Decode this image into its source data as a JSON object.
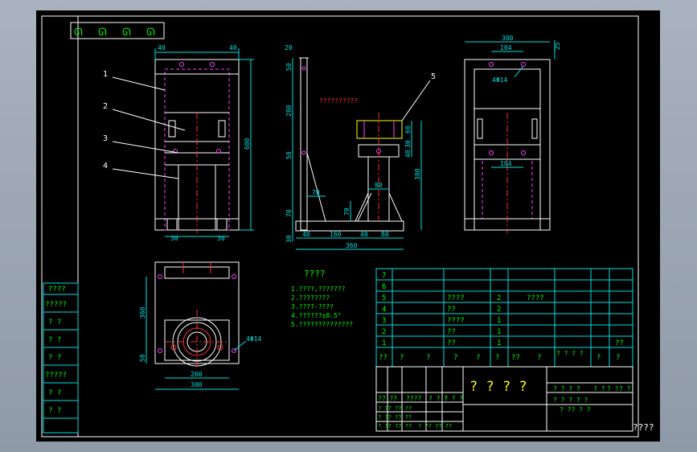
{
  "colors": {
    "background": "#000000",
    "frame": "#ffffff",
    "dim": "#00e0e0",
    "label": "#00ff00",
    "part": "#ffffff",
    "hidden": "#ff40ff",
    "center": "#ff3030",
    "highlight": "#ffff00",
    "screen_bg": "#98a3b1"
  },
  "corner_marks": [
    "ᘏ",
    "ᘏ",
    "ᘏ",
    "ᘏ"
  ],
  "front_view": {
    "dims": {
      "top_left": "40",
      "top_right": "40",
      "height": "600",
      "bottom_left": "30",
      "bottom_right": "30"
    },
    "callouts": [
      "1",
      "2",
      "3",
      "4"
    ]
  },
  "side_view": {
    "dims": {
      "top": "20",
      "v_50a": "50",
      "v_280": "280",
      "v_50b": "50",
      "v_70": "70",
      "v_30": "30",
      "h_70": "70",
      "v_70b": "70",
      "h_80": "80",
      "h_40a": "40",
      "h_160": "160",
      "h_40b": "40",
      "h_80b": "80",
      "h_360": "360",
      "v_60": "60",
      "v_30b": "30",
      "v_40": "40",
      "v_380": "380"
    },
    "callout": "5",
    "note": "??????????"
  },
  "right_view": {
    "dims": {
      "top": "300",
      "inner_top": "104",
      "corner": "25",
      "hole_note": "4Φ14",
      "inner_mid": "104"
    }
  },
  "top_view": {
    "dims": {
      "left": "360",
      "left_small": "50",
      "inner": "260",
      "outer": "300",
      "hole_note": "4Φ14"
    }
  },
  "notes": {
    "title": "????",
    "items": [
      "1.????,???????",
      "2.????????",
      "3.????-????",
      "4.??????±0.5°",
      "5.??????????????"
    ]
  },
  "bom": {
    "rows": [
      {
        "no": "7",
        "name": "",
        "qty": "",
        "mat": ""
      },
      {
        "no": "6",
        "name": "",
        "qty": "",
        "mat": ""
      },
      {
        "no": "5",
        "name": "????",
        "qty": "2",
        "mat": "????"
      },
      {
        "no": "4",
        "name": "??",
        "qty": "2",
        "mat": ""
      },
      {
        "no": "3",
        "name": "????",
        "qty": "1",
        "mat": ""
      },
      {
        "no": "2",
        "name": "??",
        "qty": "1",
        "mat": ""
      },
      {
        "no": "1",
        "name": "??",
        "qty": "1",
        "mat": "",
        "note": "??"
      }
    ],
    "header": [
      "??",
      "?",
      "?",
      "?",
      "?",
      "?",
      "??",
      "?",
      "? ? ? ?",
      "?",
      "?"
    ]
  },
  "title_block": {
    "big_title": "? ? ? ?",
    "left_cells": [
      "?? ??",
      "????",
      "? ? ?",
      "? ? ?"
    ],
    "small_rows": [
      "? ?? ?? ??",
      "? ?? ?? ??",
      "? ?? ?? ??",
      "? ?? ?? ??"
    ],
    "right_top": [
      "? ? ? ?",
      "? ?",
      "? ?",
      "? ?"
    ],
    "right_bottom": [
      "? ? ? ? ?",
      "? ?? ? ?"
    ]
  },
  "left_strip": [
    "????",
    "?????",
    "? ?",
    "? ?",
    "? ?",
    "?????",
    "? ?",
    "? ?"
  ],
  "bottom_right_text": "????"
}
